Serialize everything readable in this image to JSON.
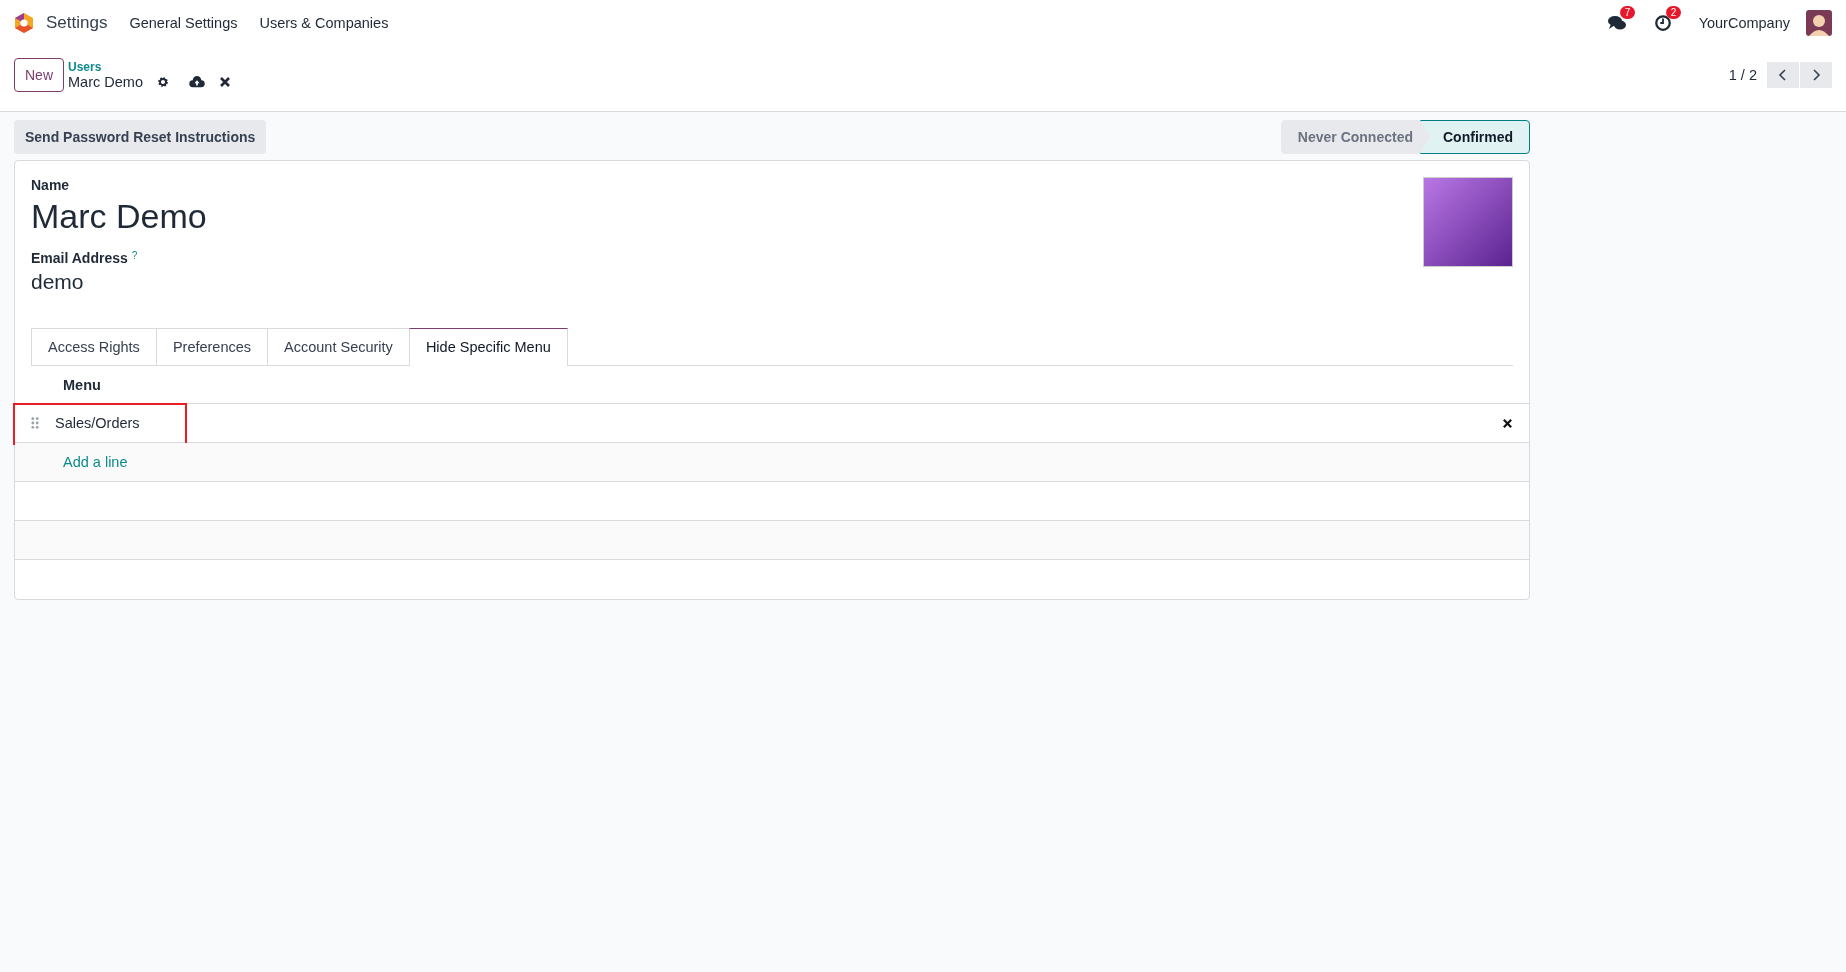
{
  "navbar": {
    "app_name": "Settings",
    "menu": [
      "General Settings",
      "Users & Companies"
    ],
    "messages_badge": "7",
    "activities_badge": "2",
    "company": "YourCompany"
  },
  "control_panel": {
    "new_button": "New",
    "breadcrumb": "Users",
    "record_name": "Marc Demo",
    "pager": "1 / 2"
  },
  "actions": {
    "button": "Send Password Reset Instructions"
  },
  "statuses": [
    {
      "label": "Never Connected",
      "selected": false
    },
    {
      "label": "Confirmed",
      "selected": true
    }
  ],
  "form": {
    "name_label": "Name",
    "name": "Marc Demo",
    "email_label": "Email Address",
    "email_help": "?",
    "email": "demo"
  },
  "tabs": [
    {
      "label": "Access Rights",
      "selected": false
    },
    {
      "label": "Preferences",
      "selected": false
    },
    {
      "label": "Account Security",
      "selected": false
    },
    {
      "label": "Hide Specific Menu",
      "selected": true
    }
  ],
  "table": {
    "column": "Menu",
    "rows": [
      {
        "menu": "Sales/Orders",
        "highlighted": true
      }
    ],
    "add_line": "Add a line"
  }
}
